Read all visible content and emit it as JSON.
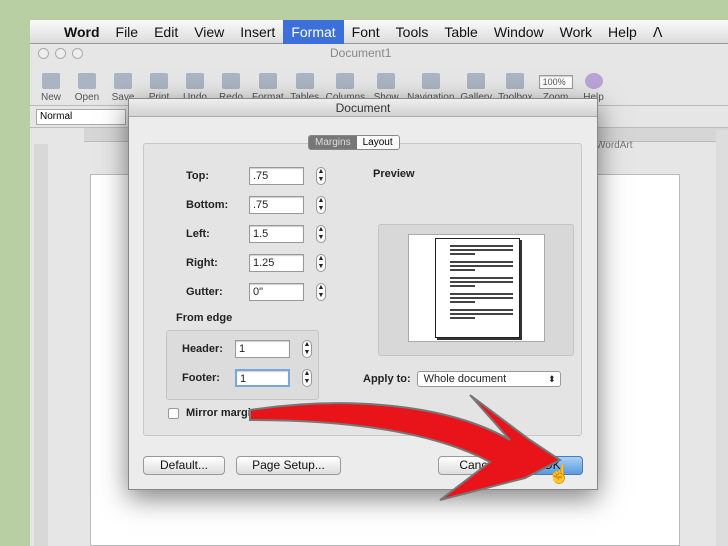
{
  "menubar": {
    "apple": "",
    "items": [
      "Word",
      "File",
      "Edit",
      "View",
      "Insert",
      "Format",
      "Font",
      "Tools",
      "Table",
      "Window",
      "Work",
      "Help"
    ],
    "script": "ⴷ"
  },
  "window": {
    "title": "Document1"
  },
  "toolbar": {
    "items": [
      "New",
      "Open",
      "Save",
      "Print",
      "Undo",
      "Redo",
      "Format",
      "Tables",
      "Columns",
      "Show",
      "Navigation",
      "Gallery",
      "Toolbox",
      "Zoom",
      "Help"
    ],
    "zoom": "100%"
  },
  "format": {
    "style": "Normal",
    "wordart": "WordArt"
  },
  "dialog": {
    "title": "Document",
    "tabs": [
      "Margins",
      "Layout"
    ],
    "fields": [
      {
        "label": "Top:",
        "value": ".75"
      },
      {
        "label": "Bottom:",
        "value": ".75"
      },
      {
        "label": "Left:",
        "value": "1.5"
      },
      {
        "label": "Right:",
        "value": "1.25"
      },
      {
        "label": "Gutter:",
        "value": "0\""
      }
    ],
    "from_edge": "From edge",
    "header": {
      "label": "Header:",
      "value": "1"
    },
    "footer": {
      "label": "Footer:",
      "value": "1"
    },
    "preview": "Preview",
    "apply_label": "Apply to:",
    "apply_value": "Whole document",
    "mirror": "Mirror margins",
    "buttons": {
      "default": "Default...",
      "page_setup": "Page Setup...",
      "cancel": "Cancel",
      "ok": "OK"
    }
  }
}
